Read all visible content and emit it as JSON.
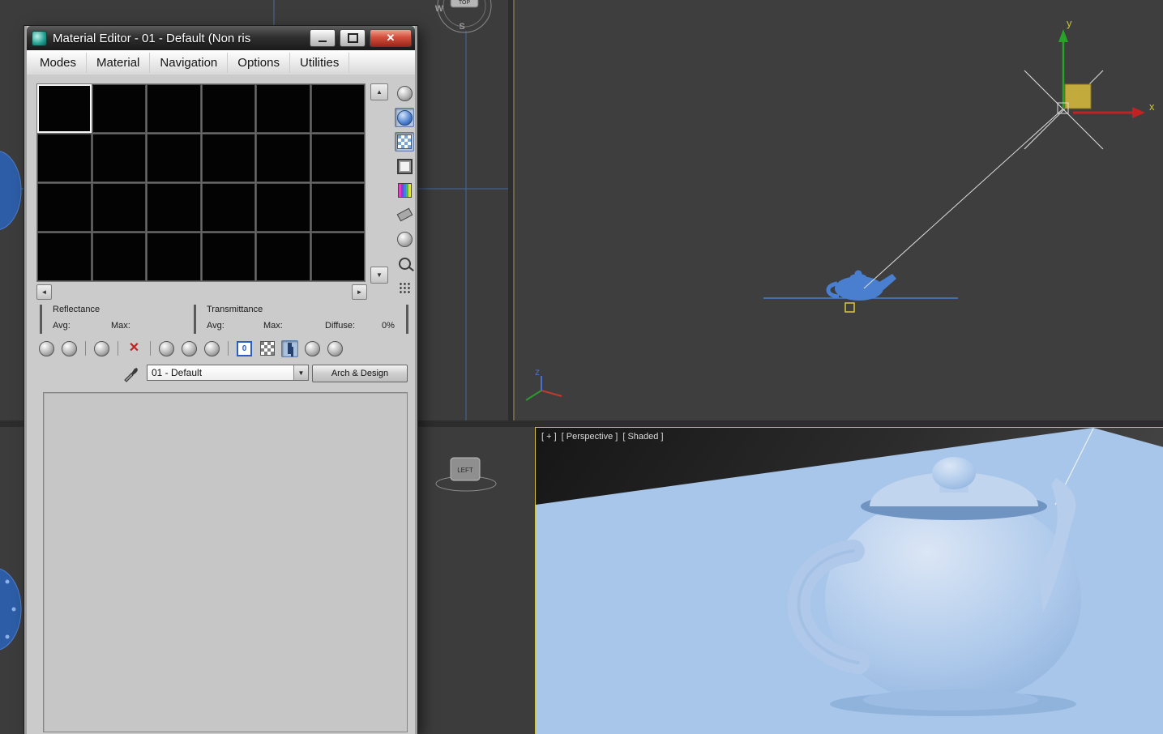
{
  "window": {
    "title": "Material Editor - 01 - Default (Non ris",
    "menu": [
      "Modes",
      "Material",
      "Navigation",
      "Options",
      "Utilities"
    ],
    "close_glyph": "✕"
  },
  "slot_nav": {
    "up": "▲",
    "down": "▼",
    "left": "◄",
    "right": "►"
  },
  "stats": {
    "reflectance": "Reflectance",
    "transmittance": "Transmittance",
    "avg": "Avg:",
    "max": "Max:",
    "diffuse": "Diffuse:",
    "diffuse_value": "0%"
  },
  "toolbar": {
    "reset_glyph": "✕",
    "material_id_value": "0"
  },
  "material": {
    "name": "01 - Default",
    "dropdown_glyph": "▼",
    "type_button": "Arch & Design"
  },
  "viewport_top": {
    "x_label": "x",
    "y_label": "y",
    "z_label": "z"
  },
  "viewport_persp": {
    "segments": [
      "[ + ]",
      "[ Perspective ]",
      "[ Shaded ]"
    ]
  },
  "compass": {
    "west": "W",
    "south": "S",
    "top": "TOP"
  },
  "left_gizmo": {
    "label": "LEFT"
  },
  "colors": {
    "active_viewport_border": "#d2c13a",
    "wireframe_blue": "#4a7fd0",
    "teapot_blue": "#aac6e8",
    "close_button_red": "#c23a2e"
  }
}
